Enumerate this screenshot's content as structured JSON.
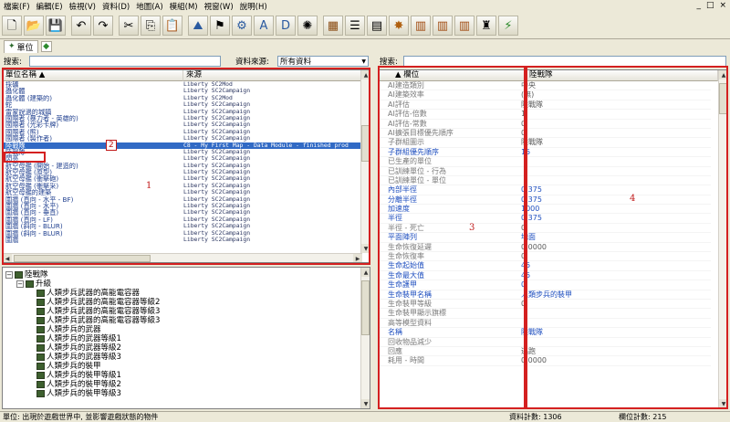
{
  "menu": [
    "檔案(F)",
    "編輯(E)",
    "檢視(V)",
    "資料(D)",
    "地圖(A)",
    "模組(M)",
    "視窗(W)",
    "說明(H)"
  ],
  "window_controls": [
    "_",
    "□",
    "×"
  ],
  "toolbar_icons": [
    "new-file-icon",
    "open-folder-icon",
    "save-icon",
    "undo-icon",
    "redo-icon",
    "cut-icon",
    "copy-icon",
    "paste-icon",
    "terrain-icon",
    "trigger-icon",
    "data-gear-icon",
    "text-icon",
    "import-icon",
    "sound-icon",
    "unit-panel-icon",
    "list-icon",
    "window-icon",
    "rock-icon",
    "book1-icon",
    "book2-icon",
    "book3-icon",
    "tower-icon",
    "game-test-icon"
  ],
  "tabs": {
    "units_label": "單位"
  },
  "search": {
    "label": "搜索:",
    "source_label": "資料來源:",
    "source_value": "所有資料",
    "right_label": "搜索:"
  },
  "unit_list": {
    "col_name": "單位名稱",
    "col_source": "來源",
    "rows": [
      {
        "name": "採礦",
        "source": "Liberty SC2Mod"
      },
      {
        "name": "蟲化體",
        "source": "Liberty SC2Campaign"
      },
      {
        "name": "蟲化體 (建築的)",
        "source": "Liberty SC2Mod"
      },
      {
        "name": "蛇",
        "source": "Liberty SC2Campaign"
      },
      {
        "name": "雷蒙說過的城鎮",
        "source": "Liberty SC2Campaign"
      },
      {
        "name": "國際者 (暴力者 - 英雄的)",
        "source": "Liberty SC2Campaign"
      },
      {
        "name": "國際者 (光彩卡牌)",
        "source": "Liberty SC2Campaign"
      },
      {
        "name": "國際者 (熊)",
        "source": "Liberty SC2Campaign"
      },
      {
        "name": "國際者 (製作者)",
        "source": "Liberty SC2Campaign"
      },
      {
        "name": "陸戰隊",
        "source": "C8 - My First Map - Data Module - finished prod"
      },
      {
        "name": "陸戰隊",
        "source": "Liberty SC2Campaign"
      },
      {
        "name": "閃亮",
        "source": "Liberty SC2Campaign"
      },
      {
        "name": "航空母艦 (開始 - 建造的)",
        "source": "Liberty SC2Campaign"
      },
      {
        "name": "航空母艦 (原型)",
        "source": "Liberty SC2Campaign"
      },
      {
        "name": "航空母艦 (衝擊砲)",
        "source": "Liberty SC2Campaign"
      },
      {
        "name": "航空母艦 (衝擊采)",
        "source": "Liberty SC2Campaign"
      },
      {
        "name": "航空母艦的建築",
        "source": "Liberty SC2Campaign"
      },
      {
        "name": "圍牆 (直向 - 水平 - BF)",
        "source": "Liberty SC2Campaign"
      },
      {
        "name": "圍牆 (直向 - 水平)",
        "source": "Liberty SC2Campaign"
      },
      {
        "name": "圍牆 (直向 - 垂直)",
        "source": "Liberty SC2Campaign"
      },
      {
        "name": "圍牆 (直向 - LF)",
        "source": "Liberty SC2Campaign"
      },
      {
        "name": "圍牆 (斜向 - BLUR)",
        "source": "Liberty SC2Campaign"
      },
      {
        "name": "圍牆 (斜向 - BLUR)",
        "source": "Liberty SC2Campaign"
      },
      {
        "name": "圍牆",
        "source": "Liberty SC2Campaign"
      }
    ]
  },
  "tree": {
    "root": "陸戰隊",
    "group": "升級",
    "items": [
      "人類步兵武器的高能電容器",
      "人類步兵武器的高能電容器等級2",
      "人類步兵武器的高能電容器等級3",
      "人類步兵武器的高能電容器等級3",
      "人類步兵的武器",
      "人類步兵的武器等級1",
      "人類步兵的武器等級2",
      "人類步兵的武器等級3",
      "人類步兵的裝甲",
      "人類步兵的裝甲等級1",
      "人類步兵的裝甲等級2",
      "人類步兵的裝甲等級3"
    ]
  },
  "props": {
    "col_field": "欄位",
    "col_value": "陸戰隊",
    "rows": [
      {
        "f": "AI建造類別",
        "v": "中央",
        "k": "gray"
      },
      {
        "f": "AI建築效率",
        "v": "(無)",
        "k": "gray"
      },
      {
        "f": "AI評估",
        "v": "陸戰隊",
        "k": "gray"
      },
      {
        "f": "AI評估-倍數",
        "v": "1",
        "k": "gray"
      },
      {
        "f": "AI評估-常數",
        "v": "0",
        "k": "gray"
      },
      {
        "f": "AI擴張目標優先順序",
        "v": "0",
        "k": "gray"
      },
      {
        "f": "子群組圖示",
        "v": "陸戰隊",
        "k": "gray"
      },
      {
        "f": "子群組優先順序",
        "v": "15",
        "k": "blue"
      },
      {
        "f": "已生產的單位",
        "v": "",
        "k": "gray"
      },
      {
        "f": "已訓練單位 - 行為",
        "v": "",
        "k": "gray"
      },
      {
        "f": "已訓練單位 - 單位",
        "v": "",
        "k": "gray"
      },
      {
        "f": "內部半徑",
        "v": "0.375",
        "k": "blue"
      },
      {
        "f": "分離半徑",
        "v": "0.375",
        "k": "blue"
      },
      {
        "f": "加速度",
        "v": "1000",
        "k": "blue"
      },
      {
        "f": "半徑",
        "v": "0.375",
        "k": "blue"
      },
      {
        "f": "半徑 - 死亡",
        "v": "0",
        "k": "gray"
      },
      {
        "f": "平面陣列",
        "v": "地面",
        "k": "blue"
      },
      {
        "f": "生命恢復延遲",
        "v": "0.0000",
        "k": "gray"
      },
      {
        "f": "生命恢復率",
        "v": "0",
        "k": "gray"
      },
      {
        "f": "生命起始值",
        "v": "45",
        "k": "blue"
      },
      {
        "f": "生命最大值",
        "v": "45",
        "k": "blue"
      },
      {
        "f": "生命護甲",
        "v": "0",
        "k": "blue"
      },
      {
        "f": "生命裝甲名稱",
        "v": "人類步兵的裝甲",
        "k": "blue"
      },
      {
        "f": "生命裝甲等級",
        "v": "0",
        "k": "gray"
      },
      {
        "f": "生命裝甲顯示旗標",
        "v": "",
        "k": "gray"
      },
      {
        "f": "高等模型資料",
        "v": "",
        "k": "gray"
      },
      {
        "f": "名稱",
        "v": "陸戰隊",
        "k": "blue"
      },
      {
        "f": "回收物品減少",
        "v": "",
        "k": "gray"
      },
      {
        "f": "回應",
        "v": "逃跑",
        "k": "gray"
      },
      {
        "f": "耗用 - 時間",
        "v": "0.0000",
        "k": "gray"
      }
    ]
  },
  "annotations": {
    "a1": "1",
    "a2": "2",
    "a3": "3",
    "a4": "4"
  },
  "status": {
    "left": "單位: 出現於遊戲世界中, 並影響遊戲狀態的物件",
    "data_count": "資料計數: 1306",
    "field_count": "欄位計數: 215"
  },
  "colors": {
    "accent": "#316ac5",
    "annotation": "#d42020",
    "field_blue": "#1f4fbf"
  }
}
